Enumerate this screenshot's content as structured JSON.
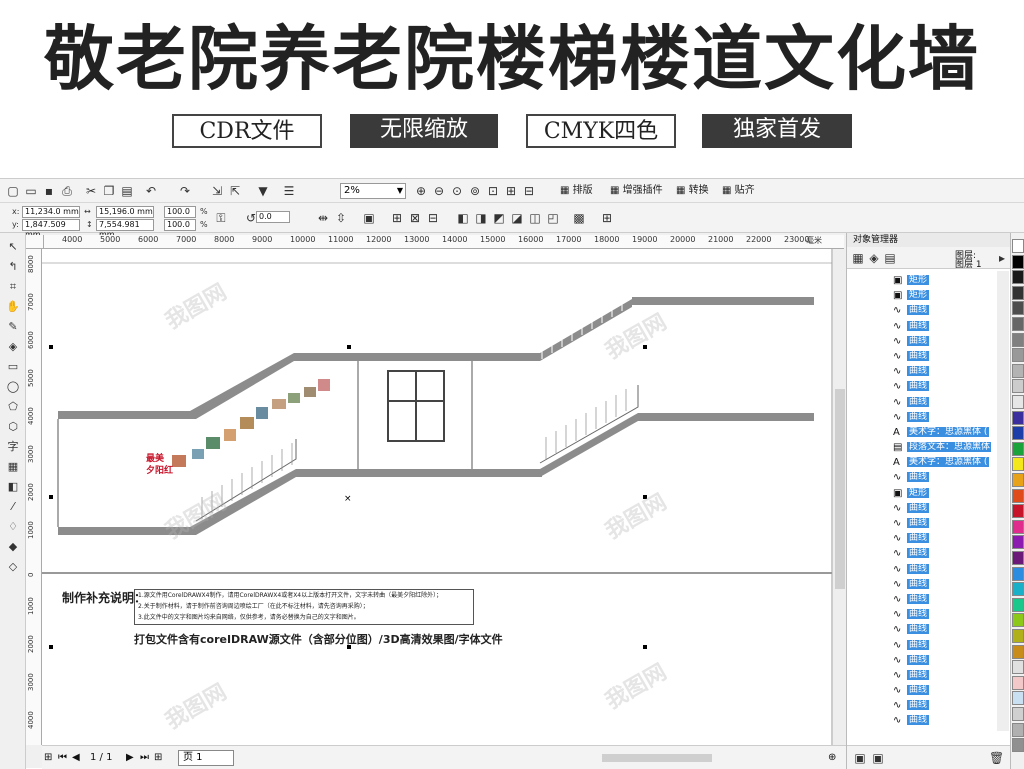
{
  "banner": {
    "title": "敬老院养老院楼梯楼道文化墙",
    "tags": [
      "CDR文件",
      "无限缩放",
      "CMYK四色",
      "独家首发"
    ]
  },
  "toolbar": {
    "zoom": "2%",
    "sort_label": "排版",
    "plugin_label": "增强插件",
    "convert_label": "转换",
    "snap_label": "贴齐"
  },
  "propbar": {
    "x_label": "x:",
    "x_value": "11,234.0 mm",
    "y_label": "y:",
    "y_value": "1,847.509 mm",
    "w_value": "15,196.0 mm",
    "h_value": "7,554.981 mm",
    "scale_x": "100.0",
    "scale_y": "100.0",
    "pct": "%",
    "rotation": "0.0"
  },
  "rulers": {
    "h_ticks": [
      "4000",
      "5000",
      "6000",
      "7000",
      "8000",
      "9000",
      "10000",
      "11000",
      "12000",
      "13000",
      "14000",
      "15000",
      "16000",
      "17000",
      "18000",
      "19000",
      "20000",
      "21000",
      "22000",
      "23000"
    ],
    "h_unit": "毫米",
    "v_ticks": [
      "8000",
      "7000",
      "6000",
      "5000",
      "4000",
      "3000",
      "2000",
      "1000",
      "0",
      "1000",
      "2000",
      "3000",
      "4000"
    ]
  },
  "canvas": {
    "note_title": "制作补充说明：",
    "note_lines": [
      "1.源文件用CorelDRAWX4制作，请用CorelDRAWX4或者X4以上版本打开文件，文字未转曲（最美夕阳红除外）；",
      "2.关于制作材料，请于制作前咨询周边喷绘工厂（在此不标注材料，请先咨询再采购）；",
      "3.此文件中的文字和图片均来自网络，仅供参考，请务必替换为自己的文字和图片。"
    ],
    "package_note": "打包文件含有coreIDRAW源文件（含部分位图）/3D高清效果图/字体文件",
    "stair_sign_1": "最美",
    "stair_sign_2": "夕阳红",
    "watermark": "我图网"
  },
  "status": {
    "page_counter": "1 / 1",
    "page_tab": "页 1"
  },
  "panel": {
    "title": "对象管理器",
    "layer_label": "图层:",
    "layer_name": "图层 1",
    "objects": [
      {
        "type": "矩形",
        "sel": true,
        "icon": "rect-icon"
      },
      {
        "type": "矩形",
        "sel": true,
        "icon": "rect-icon"
      },
      {
        "type": "曲线",
        "sel": true,
        "icon": "curve-icon"
      },
      {
        "type": "曲线",
        "sel": true,
        "icon": "curve-icon"
      },
      {
        "type": "曲线",
        "sel": true,
        "icon": "curve-icon"
      },
      {
        "type": "曲线",
        "sel": true,
        "icon": "curve-icon"
      },
      {
        "type": "曲线",
        "sel": true,
        "icon": "curve-icon"
      },
      {
        "type": "曲线",
        "sel": true,
        "icon": "curve-icon"
      },
      {
        "type": "曲线",
        "sel": true,
        "icon": "curve-icon"
      },
      {
        "type": "曲线",
        "sel": true,
        "icon": "curve-icon"
      },
      {
        "type": "美术字：思源黑体 (",
        "sel": true,
        "icon": "text-icon"
      },
      {
        "type": "段落文本：思源黑体",
        "sel": true,
        "icon": "para-icon"
      },
      {
        "type": "美术字：思源黑体 (",
        "sel": true,
        "icon": "text-icon"
      },
      {
        "type": "曲线",
        "sel": true,
        "icon": "curve-icon"
      },
      {
        "type": "矩形",
        "sel": true,
        "icon": "rect-icon"
      },
      {
        "type": "曲线",
        "sel": true,
        "icon": "curve-icon"
      },
      {
        "type": "曲线",
        "sel": true,
        "icon": "curve-icon"
      },
      {
        "type": "曲线",
        "sel": true,
        "icon": "curve-icon"
      },
      {
        "type": "曲线",
        "sel": true,
        "icon": "curve-icon"
      },
      {
        "type": "曲线",
        "sel": true,
        "icon": "curve-icon"
      },
      {
        "type": "曲线",
        "sel": true,
        "icon": "curve-icon"
      },
      {
        "type": "曲线",
        "sel": true,
        "icon": "curve-icon"
      },
      {
        "type": "曲线",
        "sel": true,
        "icon": "curve-icon"
      },
      {
        "type": "曲线",
        "sel": true,
        "icon": "curve-icon"
      },
      {
        "type": "曲线",
        "sel": true,
        "icon": "curve-icon"
      },
      {
        "type": "曲线",
        "sel": true,
        "icon": "curve-icon"
      },
      {
        "type": "曲线",
        "sel": true,
        "icon": "curve-icon"
      },
      {
        "type": "曲线",
        "sel": true,
        "icon": "curve-icon"
      },
      {
        "type": "曲线",
        "sel": true,
        "icon": "curve-icon"
      },
      {
        "type": "曲线",
        "sel": true,
        "icon": "curve-icon"
      }
    ]
  },
  "palette": [
    "#ffffff",
    "#000000",
    "#1a1a1a",
    "#333333",
    "#4d4d4d",
    "#666666",
    "#808080",
    "#999999",
    "#b3b3b3",
    "#cccccc",
    "#e6e6e6",
    "#3b2fa0",
    "#1b3ea8",
    "#1aa23b",
    "#f2e81b",
    "#e8a21a",
    "#e04b1a",
    "#c8142a",
    "#e02c8c",
    "#8c1ab0",
    "#6b1a7a",
    "#2c8ce0",
    "#1ab0c8",
    "#1ac88c",
    "#8cc81a",
    "#b0b01a",
    "#c88c1a",
    "#e0e0e0",
    "#f2c8c8",
    "#c8e0f2",
    "#d0d0d0",
    "#b0b0b0",
    "#909090"
  ],
  "colors": {
    "selection": "#3b8fe0",
    "stair_gray": "#8c8c8c"
  }
}
